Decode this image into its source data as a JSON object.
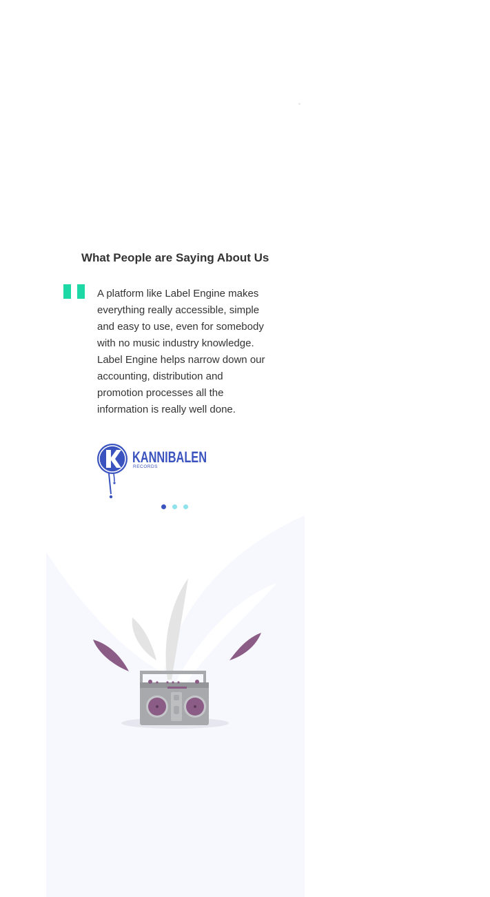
{
  "testimonials": {
    "heading": "What People are Saying About Us",
    "quote": "A platform like Label Engine makes everything really accessible, simple and easy to use, even for somebody with no music industry knowledge. Label Engine helps narrow down our accounting, distribution and promotion processes all the information is really well done.",
    "company_logo": {
      "name": "KANNIBALEN",
      "subtitle": "RECORDS",
      "letter": "K",
      "color": "#3a53bf"
    },
    "carousel": {
      "total_slides": 3,
      "active_slide": 1,
      "active_color": "#3a53bf",
      "inactive_color": "#8ee2ec"
    },
    "quote_icon": "quote-icon",
    "accent_color": "#1ed8a6"
  },
  "illustration": {
    "icon": "boombox-splash-illustration",
    "background_color": "#f7f8fe"
  }
}
